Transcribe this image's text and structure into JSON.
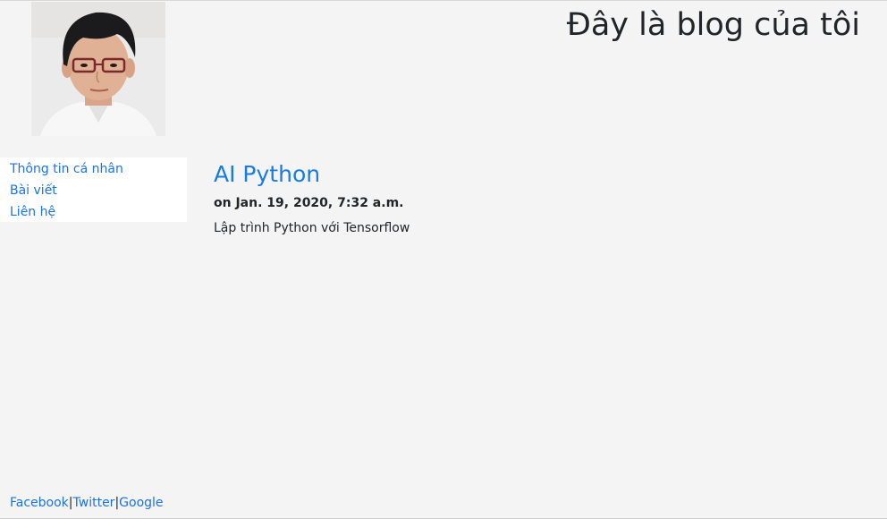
{
  "header": {
    "title": "Đây là blog của tôi",
    "avatar_icon": "person-portrait"
  },
  "sidebar": {
    "items": [
      {
        "label": "Thông tin cá nhân"
      },
      {
        "label": "Bài viết"
      },
      {
        "label": "Liên hệ"
      }
    ]
  },
  "post": {
    "title": "AI Python",
    "date": "on Jan. 19, 2020, 7:32 a.m.",
    "body": "Lập trình Python với Tensorflow"
  },
  "footer": {
    "links": [
      {
        "label": "Facebook"
      },
      {
        "label": "Twitter"
      },
      {
        "label": "Google"
      }
    ],
    "separator": "|"
  },
  "colors": {
    "background": "#f4f4f4",
    "link": "#1a73e8",
    "post_title": "#1a7be0",
    "text": "#212529",
    "sidebar_bg": "#ffffff"
  }
}
